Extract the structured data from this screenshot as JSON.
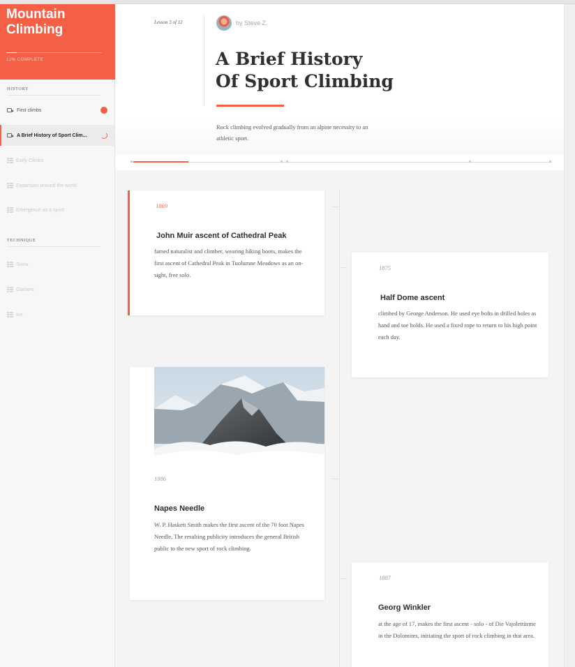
{
  "course": {
    "title_line1": "Mountain",
    "title_line2": "Climbing",
    "progress_fraction": 0.11,
    "complete_label": "11% COMPLETE"
  },
  "sidebar": {
    "sections": [
      {
        "title": "HISTORY",
        "items": [
          {
            "label": "First climbs",
            "icon": "video-icon",
            "status": "complete"
          },
          {
            "label": "A Brief History of Sport Clim...",
            "icon": "video-icon",
            "status": "in-progress"
          },
          {
            "label": "Early Climbs",
            "icon": "list-icon",
            "status": "locked"
          },
          {
            "label": "Expansion around the world",
            "icon": "list-icon",
            "status": "locked"
          },
          {
            "label": "Emergence as a sport",
            "icon": "list-icon",
            "status": "locked"
          }
        ]
      },
      {
        "title": "TECHNIQUE",
        "items": [
          {
            "label": "Snow",
            "icon": "list-icon",
            "status": "locked"
          },
          {
            "label": "Glaciers",
            "icon": "list-icon",
            "status": "locked"
          },
          {
            "label": "Ice",
            "icon": "list-icon",
            "status": "locked"
          }
        ]
      }
    ]
  },
  "lesson": {
    "number": "Lesson 3 of 12",
    "author": "by Steve Z.",
    "title_line1": "A Brief History",
    "title_line2": "Of Sport Climbing",
    "description": "Rock climbing evolved gradually from an alpine necessity to an athletic sport.",
    "progress_fraction": 0.13
  },
  "timeline": [
    {
      "year": "1869",
      "title": "John Muir ascent of Cathedral Peak",
      "text": "famed naturalist and climber, wearing hiking boots, makes the first ascent of Cathedral Peak in Tuolumne Meadows as an on-sight, free solo."
    },
    {
      "year": "1875",
      "title": "Half Dome ascent",
      "text": "climbed by George Anderson. He used eye bolts in drilled holes as hand and toe holds. He used a fixed rope to return to his high point each day."
    },
    {
      "year": "1886",
      "title": "Napes Needle",
      "text": "W. P. Haskett Smith makes the first ascent of the 70 foot Napes Needle, The resulting publicity introduces the general British public to the new sport of rock climbing.",
      "image": "mountain-peak-photo"
    },
    {
      "year": "1887",
      "title": "Georg Winkler",
      "text": "at the age of 17, makes the first ascent - solo - of Die Vajolettürme in the Dolomites, initiating the sport of rock climbing in that area."
    }
  ],
  "colors": {
    "accent": "#f55f46",
    "text": "#2c2c2c",
    "muted": "#9a9a9a"
  }
}
